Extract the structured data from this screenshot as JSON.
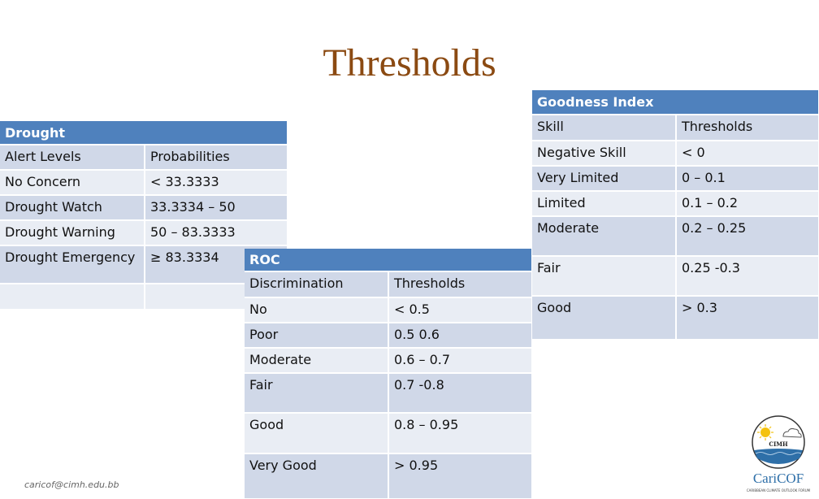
{
  "title": "Thresholds",
  "drought": {
    "header": "Drought",
    "columns": [
      "Alert Levels",
      "Probabilities"
    ],
    "rows": [
      [
        "No Concern",
        "< 33.3333"
      ],
      [
        "Drought Watch",
        "33.3334 – 50"
      ],
      [
        "Drought Warning",
        "50 – 83.3333"
      ],
      [
        "Drought Emergency",
        "≥ 83.3334"
      ],
      [
        "",
        ""
      ]
    ]
  },
  "roc": {
    "header": "ROC",
    "columns": [
      "Discrimination",
      "Thresholds"
    ],
    "rows": [
      [
        "No",
        "< 0.5"
      ],
      [
        "Poor",
        "0.5 0.6"
      ],
      [
        "Moderate",
        "0.6 – 0.7"
      ],
      [
        "Fair",
        "0.7 -0.8"
      ],
      [
        "Good",
        "0.8 – 0.95"
      ],
      [
        "Very Good",
        "> 0.95"
      ]
    ]
  },
  "goodness": {
    "header": "Goodness Index",
    "columns": [
      "Skill",
      "Thresholds"
    ],
    "rows": [
      [
        "Negative Skill",
        "< 0"
      ],
      [
        "Very Limited",
        "0 – 0.1"
      ],
      [
        "Limited",
        "0.1 – 0.2"
      ],
      [
        "Moderate",
        "0.2 – 0.25"
      ],
      [
        "Fair",
        "0.25 -0.3"
      ],
      [
        "Good",
        "> 0.3"
      ]
    ]
  },
  "footer": {
    "email": "caricof@cimh.edu.bb",
    "logo_badge_text": "CIMH",
    "logo_text": "CariCOF",
    "logo_subtext": "CARIBBEAN CLIMATE OUTLOOK FORUM"
  },
  "colors": {
    "title": "#8b4a12",
    "header_bg": "#4f81bd",
    "row_dark": "#d0d8e8",
    "row_light": "#e9edf4",
    "logo_blue": "#2e6fa8"
  }
}
